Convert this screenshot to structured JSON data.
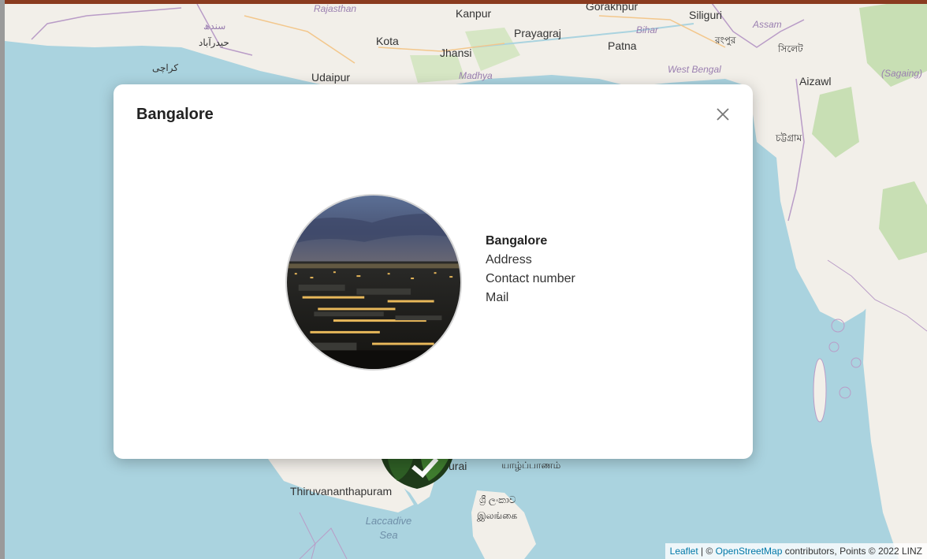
{
  "modal": {
    "title": "Bangalore",
    "info": {
      "name": "Bangalore",
      "address_label": "Address",
      "contact_label": "Contact number",
      "mail_label": "Mail"
    }
  },
  "map_labels": {
    "rajasthan": "Rajasthan",
    "kanpur": "Kanpur",
    "gorakhpur": "Gorakhpur",
    "siliguri": "Siliguri",
    "assam": "Assam",
    "sindh": "سندھ",
    "hyderabad": "حيدرآباد",
    "karachi": "کراچی",
    "kota": "Kota",
    "prayagraj": "Prayagraj",
    "bihar": "Bihar",
    "rangpur": "রংপুর",
    "sylhet": "সিলেট",
    "jhansi": "Jhansi",
    "patna": "Patna",
    "udaipur": "Udaipur",
    "madhya": "Madhya",
    "west_bengal": "West Bengal",
    "aizawl": "Aizawl",
    "chittagong": "চট্টগ্রাম",
    "sagaing": "(Sagaing)",
    "thiruvananthapuram": "Thiruvananthapuram",
    "madurai": "urai",
    "jaffna": "யாழ்ப்பாணம்",
    "sri_lanka_si": "ශ්‍රී ලංකාව",
    "sri_lanka_ta": "இலங்கை",
    "laccadive_sea": "Laccadive Sea"
  },
  "attribution": {
    "leaflet": "Leaflet",
    "separator": "| ©",
    "osm": "OpenStreetMap",
    "rest": "contributors, Points © 2022 LINZ"
  },
  "colors": {
    "water": "#aad3df",
    "land": "#f2efe9",
    "forest": "#c8dfb4",
    "accent": "#0078a8"
  },
  "icons": {
    "close": "close-icon",
    "marker": "map-marker-icon"
  }
}
